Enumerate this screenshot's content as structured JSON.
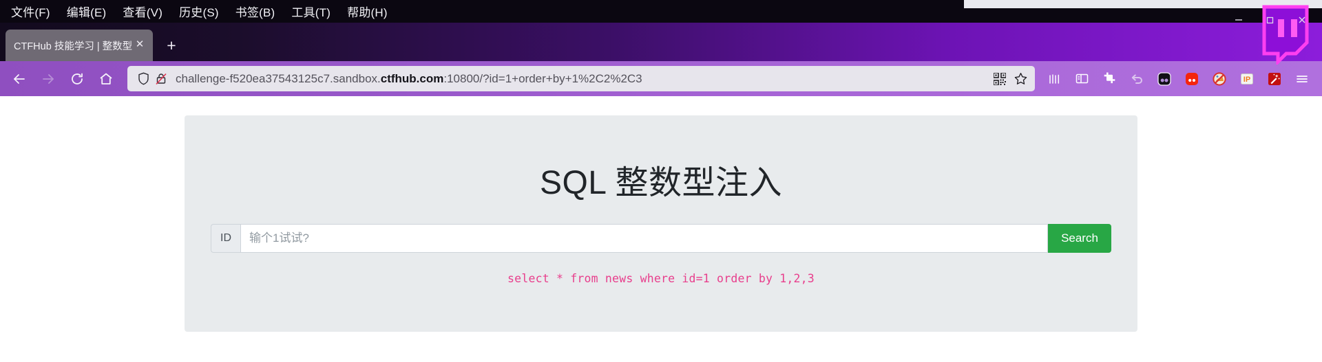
{
  "browser": {
    "menu_items": [
      {
        "label": "文件(F)",
        "mnemonic": "F"
      },
      {
        "label": "编辑(E)",
        "mnemonic": "E"
      },
      {
        "label": "查看(V)",
        "mnemonic": "V"
      },
      {
        "label": "历史(S)",
        "mnemonic": "S"
      },
      {
        "label": "书签(B)",
        "mnemonic": "B"
      },
      {
        "label": "工具(T)",
        "mnemonic": "T"
      },
      {
        "label": "帮助(H)",
        "mnemonic": "H"
      }
    ],
    "tab": {
      "title": "CTFHub 技能学习 | 整数型注入",
      "close_label": "✕"
    },
    "new_tab_label": "+",
    "window_controls": {
      "minimize": "—",
      "maximize": "❐",
      "close": "✕"
    },
    "url": {
      "prefix": "challenge-f520ea37543125c7.sandbox.",
      "host": "ctfhub.com",
      "suffix": ":10800/?id=1+order+by+1%2C2%2C3",
      "full": "challenge-f520ea37543125c7.sandbox.ctfhub.com:10800/?id=1+order+by+1%2C2%2C3"
    },
    "nav": {
      "back": "back-arrow",
      "forward": "forward-arrow",
      "reload": "reload-arrow",
      "home": "home-house"
    },
    "toolbar_icons": [
      "library-icon",
      "sidebar-icon",
      "screenshot-crop-icon",
      "undo-close-tab-icon",
      "dark-reader-extension-icon",
      "red-extension-icon",
      "adblock-extension-icon",
      "ip-extension-icon",
      "magic-wand-extension-icon",
      "app-menu-icon"
    ],
    "url_actions": [
      "qr-code-icon",
      "bookmark-star-icon"
    ],
    "colors": {
      "accent_purple": "#9e5fd0",
      "tab_strip_dark": "#1b0d2b",
      "menubar_bg": "#0b0711"
    }
  },
  "page": {
    "title": "SQL 整数型注入",
    "form": {
      "addon_label": "ID",
      "input_value": "",
      "input_placeholder": "输个1试试?",
      "submit_label": "Search"
    },
    "sql_result": "select * from news where id=1 order by 1,2,3",
    "colors": {
      "card_bg": "#e8ebed",
      "submit_green": "#28a745",
      "sql_pink": "#e83e8c"
    }
  }
}
